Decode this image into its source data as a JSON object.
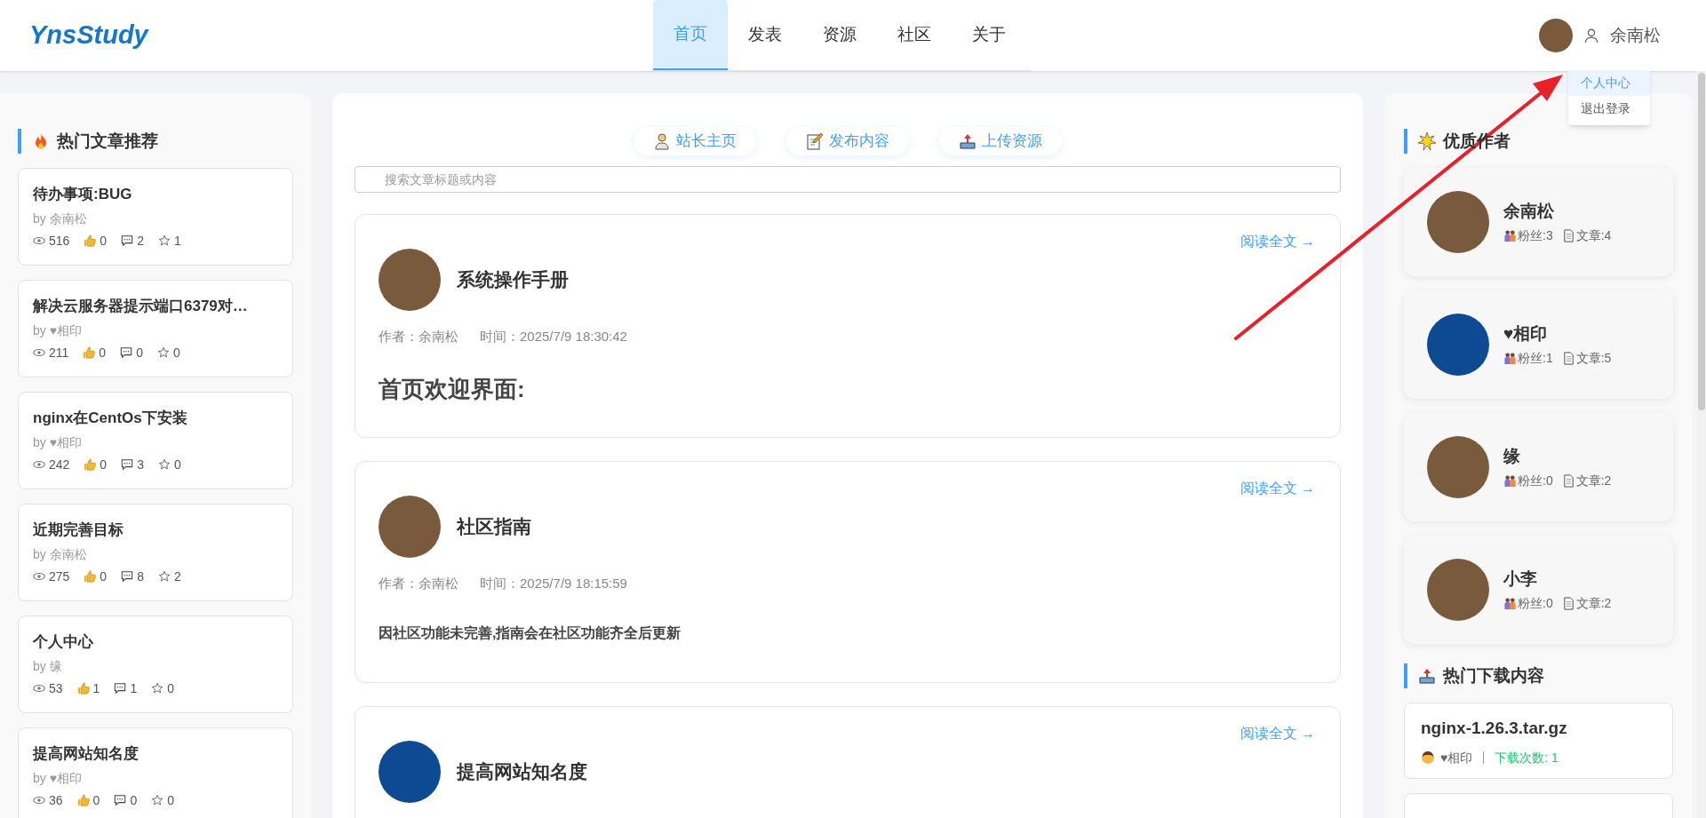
{
  "header": {
    "logo": "YnsStudy",
    "nav": [
      {
        "label": "首页",
        "selected": true
      },
      {
        "label": "发表",
        "selected": false
      },
      {
        "label": "资源",
        "selected": false
      },
      {
        "label": "社区",
        "selected": false
      },
      {
        "label": "关于",
        "selected": false
      }
    ],
    "user": {
      "name": "余南松"
    },
    "user_menu": [
      {
        "label": "个人中心",
        "selected": true
      },
      {
        "label": "退出登录",
        "selected": false
      }
    ]
  },
  "hot_articles": {
    "title": "热门文章推荐",
    "items": [
      {
        "title": "待办事项:BUG",
        "author": "by 余南松",
        "views": "516",
        "likes": "0",
        "comments": "2",
        "favorites": "1"
      },
      {
        "title": "解决云服务器提示端口6379对…",
        "author": "by ♥相印",
        "views": "211",
        "likes": "0",
        "comments": "0",
        "favorites": "0"
      },
      {
        "title": "nginx在CentOs下安装",
        "author": "by ♥相印",
        "views": "242",
        "likes": "0",
        "comments": "3",
        "favorites": "0"
      },
      {
        "title": "近期完善目标",
        "author": "by 余南松",
        "views": "275",
        "likes": "0",
        "comments": "8",
        "favorites": "2"
      },
      {
        "title": "个人中心",
        "author": "by 缘",
        "views": "53",
        "likes": "1",
        "comments": "1",
        "favorites": "0"
      },
      {
        "title": "提高网站知名度",
        "author": "by ♥相印",
        "views": "36",
        "likes": "0",
        "comments": "0",
        "favorites": "0"
      }
    ]
  },
  "actions": [
    {
      "label": "站长主页"
    },
    {
      "label": "发布内容"
    },
    {
      "label": "上传资源"
    }
  ],
  "search": {
    "placeholder": "搜索文章标题或内容"
  },
  "posts": [
    {
      "title": "系统操作手册",
      "kind": "photo",
      "author": "作者：余南松",
      "time": "时间：2025/7/9 18:30:42",
      "read_more": "阅读全文 →",
      "body": {
        "kind": "heading",
        "text": "首页欢迎界面:"
      }
    },
    {
      "title": "社区指南",
      "kind": "photo",
      "author": "作者：余南松",
      "time": "时间：2025/7/9 18:15:59",
      "read_more": "阅读全文 →",
      "body": {
        "kind": "paragraph",
        "text": "因社区功能未完善,指南会在社区功能齐全后更新"
      }
    },
    {
      "title": "提高网站知名度",
      "kind": "logo",
      "read_more": "阅读全文 →"
    }
  ],
  "authors": {
    "title": "优质作者",
    "items": [
      {
        "name": "余南松",
        "kind": "photo",
        "fans": "粉丝:3",
        "articles": "文章:4"
      },
      {
        "name": "♥相印",
        "kind": "logo",
        "fans": "粉丝:1",
        "articles": "文章:5"
      },
      {
        "name": "缘",
        "kind": "photo",
        "fans": "粉丝:0",
        "articles": "文章:2"
      },
      {
        "name": "小李",
        "kind": "photo",
        "fans": "粉丝:0",
        "articles": "文章:2"
      }
    ]
  },
  "downloads": {
    "title": "热门下载内容",
    "items": [
      {
        "name": "nginx-1.26.3.tar.gz",
        "uploader": "♥相印",
        "count": "下载次数: 1"
      }
    ]
  }
}
